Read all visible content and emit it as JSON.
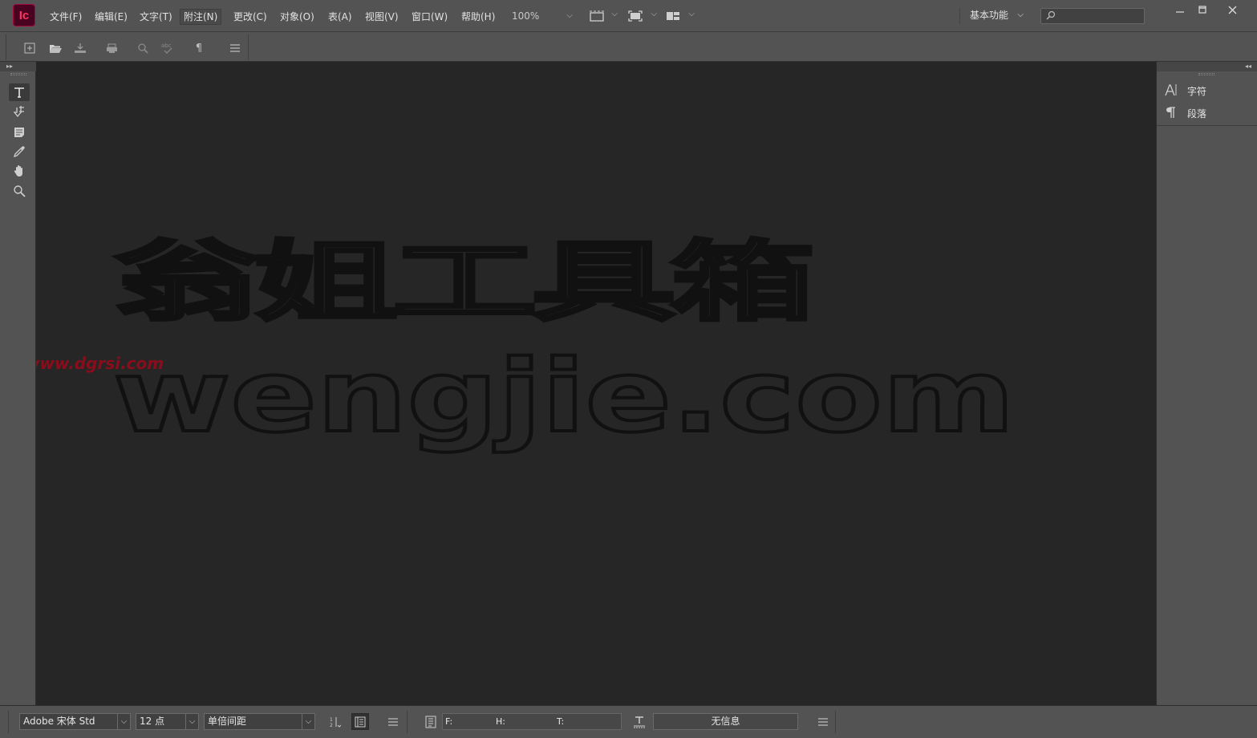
{
  "app": {
    "logo": "Ic",
    "accent_color": "#ff3366",
    "canvas_color": "#262626"
  },
  "menu": {
    "items": [
      {
        "label": "文件(F)"
      },
      {
        "label": "编辑(E)"
      },
      {
        "label": "文字(T)"
      },
      {
        "label": "附注(N)"
      },
      {
        "label": "更改(C)"
      },
      {
        "label": "对象(O)"
      },
      {
        "label": "表(A)"
      },
      {
        "label": "视图(V)"
      },
      {
        "label": "窗口(W)"
      },
      {
        "label": "帮助(H)"
      }
    ],
    "zoom": "100%",
    "workspace": "基本功能",
    "search_placeholder": ""
  },
  "control_bar": {
    "icons": [
      "new-document-icon",
      "open-folder-icon",
      "save-icon",
      "print-icon",
      "find-icon",
      "spellcheck-icon",
      "pilcrow-icon",
      "menu-icon"
    ]
  },
  "tools": [
    "type-tool-icon",
    "position-tool-icon",
    "note-tool-icon",
    "eyedropper-tool-icon",
    "hand-tool-icon",
    "zoom-tool-icon"
  ],
  "right_panel": {
    "tabs": [
      {
        "label": "字符",
        "icon": "character-icon"
      },
      {
        "label": "段落",
        "icon": "paragraph-icon"
      }
    ]
  },
  "watermark": {
    "line1": "翁姐工具箱",
    "url_small": "www.dgrsi.com",
    "line2": "wengjie.com"
  },
  "bottom_bar": {
    "font_family": "Adobe 宋体 Std",
    "font_size": "12 点",
    "line_spacing": "单倍间距",
    "info_f": "F:",
    "info_h": "H:",
    "info_t": "T:",
    "status": "无信息"
  }
}
